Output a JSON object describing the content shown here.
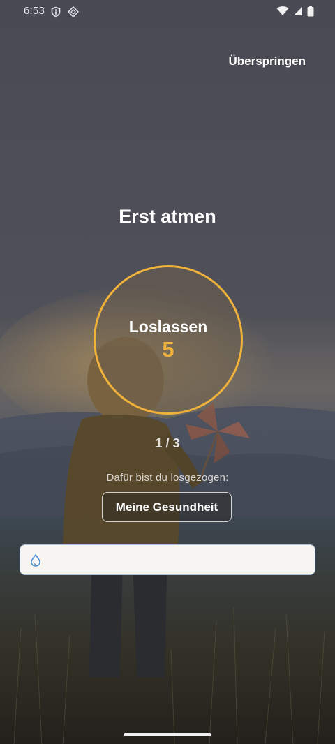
{
  "status_bar": {
    "time": "6:53",
    "left_icons": [
      "shield-icon",
      "vpn-diamond-icon"
    ],
    "right_icons": [
      "wifi-icon",
      "cell-signal-icon",
      "battery-icon"
    ]
  },
  "header": {
    "skip_label": "Überspringen"
  },
  "main": {
    "title": "Erst atmen",
    "breath": {
      "phase_label": "Loslassen",
      "count": "5",
      "accent_color": "#f0b23a"
    },
    "progress": "1 / 3",
    "reason_prompt": "Dafür bist du losgezogen:",
    "reason_chip": "Meine Gesundheit"
  },
  "input": {
    "icon": "drop-icon",
    "value": "",
    "placeholder": ""
  }
}
